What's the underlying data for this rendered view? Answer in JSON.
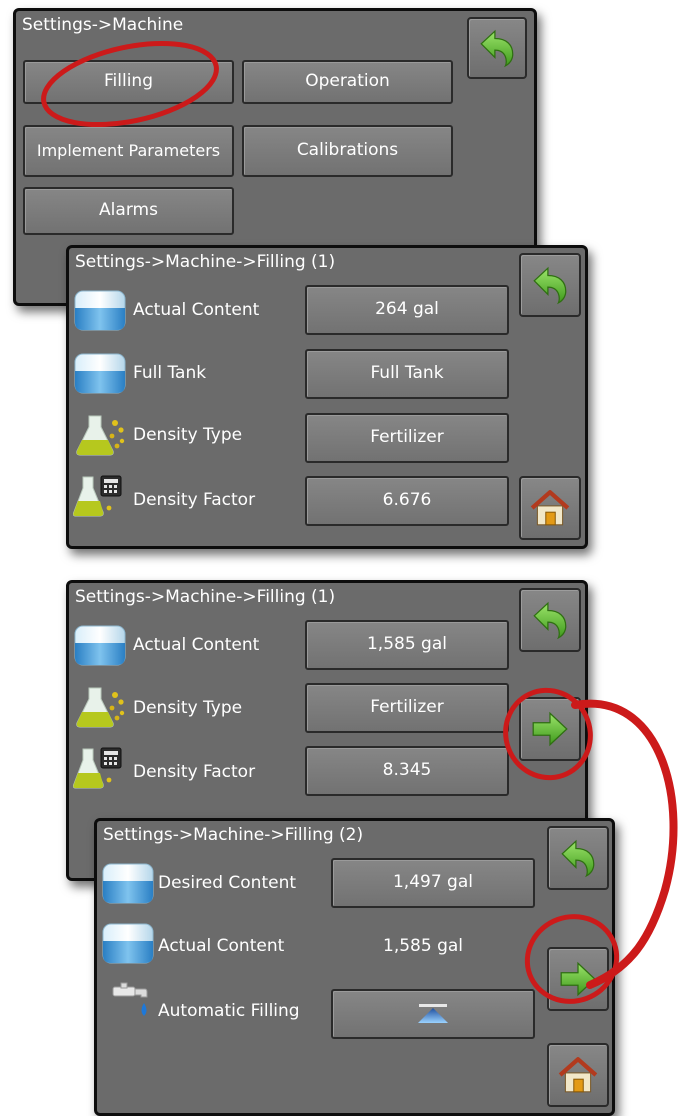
{
  "panel1": {
    "title": "Settings->Machine",
    "buttons": {
      "filling": "Filling",
      "operation": "Operation",
      "implement": "Implement Parameters",
      "calibrations": "Calibrations",
      "alarms": "Alarms"
    }
  },
  "panel2": {
    "title": "Settings->Machine->Filling (1)",
    "rows": [
      {
        "label": "Actual Content",
        "value": "264 gal"
      },
      {
        "label": "Full Tank",
        "value": "Full Tank"
      },
      {
        "label": "Density Type",
        "value": "Fertilizer"
      },
      {
        "label": "Density Factor",
        "value": "6.676"
      }
    ]
  },
  "panel3": {
    "title": "Settings->Machine->Filling (1)",
    "rows": [
      {
        "label": "Actual Content",
        "value": "1,585 gal"
      },
      {
        "label": "Density Type",
        "value": "Fertilizer"
      },
      {
        "label": "Density Factor",
        "value": "8.345"
      }
    ]
  },
  "panel4": {
    "title": "Settings->Machine->Filling (2)",
    "rows": [
      {
        "label": "Desired Content",
        "value": "1,497 gal"
      },
      {
        "label": "Actual Content",
        "value": "1,585 gal"
      },
      {
        "label": "Automatic Filling"
      }
    ]
  },
  "icons": {
    "back": "back-arrow-icon",
    "home": "home-icon",
    "next": "next-arrow-icon",
    "tank": "tank-icon",
    "density": "density-flask-icon",
    "calculator": "calculator-flask-icon",
    "faucet": "faucet-icon",
    "fill_toggle": "fill-up-triangle-icon"
  },
  "colors": {
    "panel_bg": "#6b6b6b",
    "button": "#7c7c7c",
    "accent_green": "#53b324",
    "annotation_red": "#cc1a1a"
  }
}
